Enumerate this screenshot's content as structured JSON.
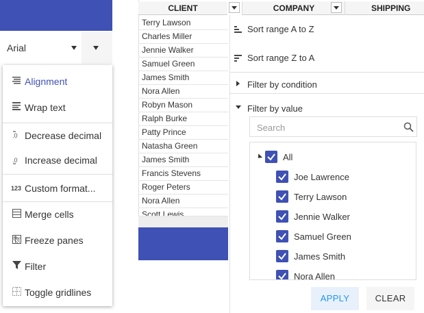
{
  "toolbar": {
    "font_value": "Arial"
  },
  "menu": {
    "items": [
      {
        "label": "Alignment",
        "icon": "align-icon"
      },
      {
        "label": "Wrap text",
        "icon": "wrap-text-icon"
      },
      {
        "label": "Decrease decimal",
        "icon": "decrease-decimal-icon"
      },
      {
        "label": "Increase decimal",
        "icon": "increase-decimal-icon"
      },
      {
        "label": "Custom format...",
        "icon": "custom-format-icon",
        "icon_text": "123"
      },
      {
        "label": "Merge cells",
        "icon": "merge-cells-icon"
      },
      {
        "label": "Freeze panes",
        "icon": "freeze-panes-icon"
      },
      {
        "label": "Filter",
        "icon": "filter-icon"
      },
      {
        "label": "Toggle gridlines",
        "icon": "gridlines-icon"
      }
    ]
  },
  "grid": {
    "headers": [
      "CLIENT",
      "COMPANY",
      "SHIPPING"
    ],
    "rows": [
      "Terry Lawson",
      "Charles Miller",
      "Jennie Walker",
      "Samuel Green",
      "James Smith",
      "Nora Allen",
      "Robyn Mason",
      "Ralph Burke",
      "Patty Prince",
      "Natasha Green",
      "James Smith",
      "Francis Stevens",
      "Roger Peters",
      "Nora Allen",
      "Scott Lewis"
    ]
  },
  "filter": {
    "sort_asc": "Sort range A to Z",
    "sort_desc": "Sort range Z to A",
    "by_condition": "Filter by condition",
    "by_value": "Filter by value",
    "search_placeholder": "Search",
    "all_label": "All",
    "values": [
      "Joe Lawrence",
      "Terry Lawson",
      "Jennie Walker",
      "Samuel Green",
      "James Smith",
      "Nora Allen"
    ],
    "apply": "APPLY",
    "clear": "CLEAR"
  },
  "colors": {
    "accent": "#3f51b5",
    "apply_bg": "#e8f1fb",
    "apply_text": "#2196f3"
  }
}
